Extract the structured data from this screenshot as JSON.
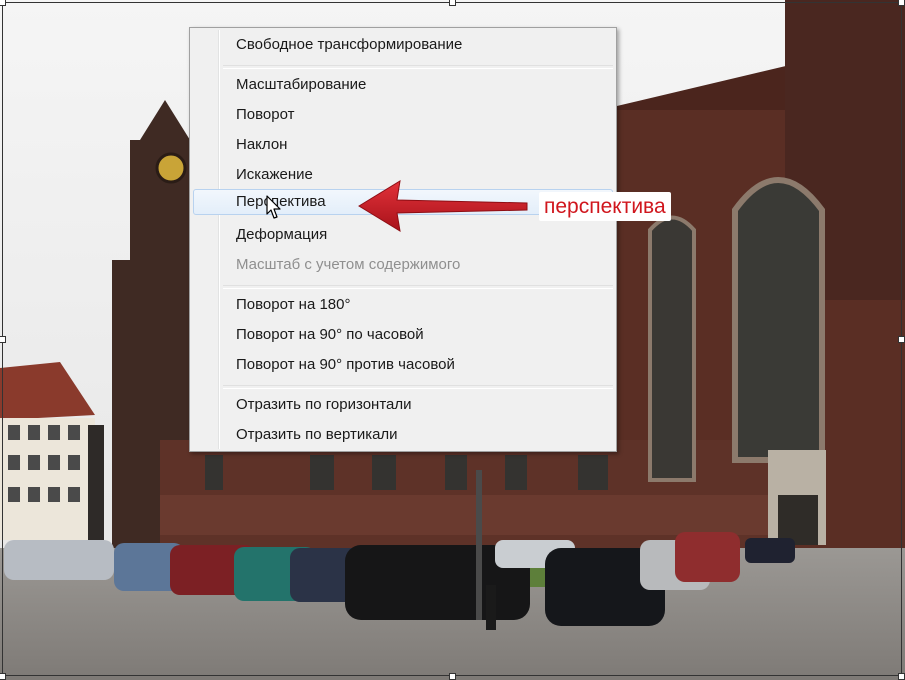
{
  "menu": {
    "items": [
      {
        "label": "Свободное трансформирование",
        "enabled": true
      },
      {
        "label": "Масштабирование",
        "enabled": true
      },
      {
        "label": "Поворот",
        "enabled": true
      },
      {
        "label": "Наклон",
        "enabled": true
      },
      {
        "label": "Искажение",
        "enabled": true
      },
      {
        "label": "Перспектива",
        "enabled": true,
        "highlighted": true
      },
      {
        "label": "Деформация",
        "enabled": true
      },
      {
        "label": "Масштаб с учетом содержимого",
        "enabled": false
      },
      {
        "label": "Поворот на 180°",
        "enabled": true
      },
      {
        "label": "Поворот на 90° по часовой",
        "enabled": true
      },
      {
        "label": "Поворот на 90° против часовой",
        "enabled": true
      },
      {
        "label": "Отразить по горизонтали",
        "enabled": true
      },
      {
        "label": "Отразить по вертикали",
        "enabled": true
      }
    ]
  },
  "annotation": {
    "text": "перспектива",
    "color": "#d0161d",
    "arrow_color": "#c41a1f"
  },
  "colors": {
    "sky": "#f2f2f2",
    "brick": "#5b2e24",
    "pavement": "#8a8784"
  },
  "icons": {
    "cursor": "arrow-pointer-icon",
    "arrow": "red-left-arrow-icon"
  }
}
